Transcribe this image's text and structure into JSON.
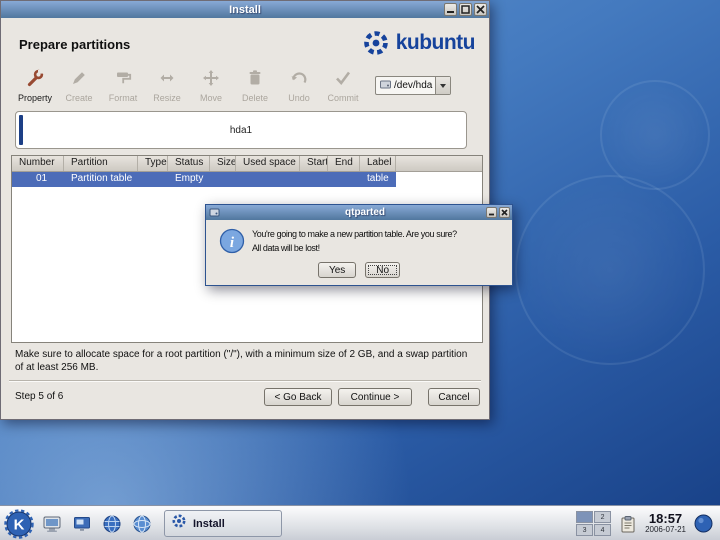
{
  "main_window": {
    "title": "Install",
    "heading": "Prepare partitions",
    "logo_text": "kubuntu",
    "toolbar": {
      "buttons": [
        {
          "label": "Property"
        },
        {
          "label": "Create"
        },
        {
          "label": "Format"
        },
        {
          "label": "Resize"
        },
        {
          "label": "Move"
        },
        {
          "label": "Delete"
        },
        {
          "label": "Undo"
        },
        {
          "label": "Commit"
        }
      ],
      "device_value": "/dev/hda"
    },
    "disk_label": "hda1",
    "table": {
      "columns": [
        "Number",
        "Partition",
        "Type",
        "Status",
        "Size",
        "Used space",
        "Start",
        "End",
        "Label"
      ],
      "row": {
        "number": "01",
        "partition": "Partition table",
        "type": "",
        "status": "Empty",
        "size": "",
        "used_space": "",
        "start": "",
        "end": "",
        "label": "table"
      }
    },
    "note": "Make sure to allocate space for a root partition (\"/\"), with a minimum size of 2 GB, and a swap partition of at least 256 MB.",
    "step_label": "Step 5 of 6",
    "buttons": {
      "back": "< Go Back",
      "continue": "Continue >",
      "cancel": "Cancel"
    }
  },
  "dialog": {
    "title": "qtparted",
    "message_line1": "You're going to make a new partition table. Are you sure?",
    "message_line2": "All data will be lost!",
    "buttons": {
      "yes": "Yes",
      "no": "No"
    }
  },
  "taskbar": {
    "task_label": "Install",
    "pager": {
      "desktop2": "2",
      "desktop3": "3",
      "desktop4": "4"
    },
    "clock_time": "18:57",
    "clock_date": "2006-07-21"
  },
  "icons": {
    "kmenu_letter": "K",
    "info_glyph": "i"
  }
}
